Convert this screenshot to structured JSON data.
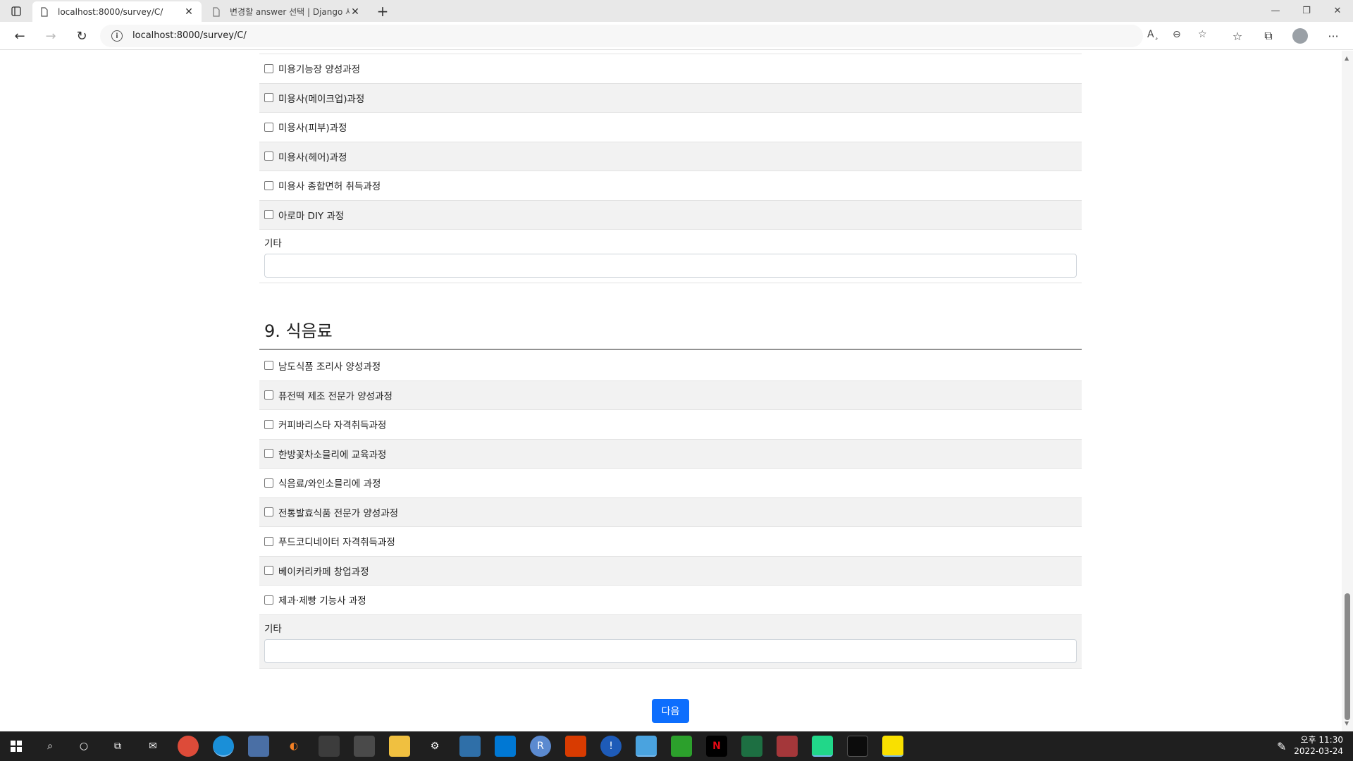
{
  "browser": {
    "tabs": [
      {
        "title": "localhost:8000/survey/C/",
        "active": true
      },
      {
        "title": "변경할 answer 선택 | Django 사이",
        "active": false
      }
    ],
    "url": "localhost:8000/survey/C/",
    "read_aloud": "A¸"
  },
  "section_prev": {
    "options": [
      "미용기능장 양성과정",
      "미용사(메이크업)과정",
      "미용사(피부)과정",
      "미용사(헤어)과정",
      "미용사 종합면허 취득과정",
      "아로마 DIY 과정"
    ],
    "etc_label": "기타"
  },
  "section_9": {
    "title": "9. 식음료",
    "options": [
      "남도식품 조리사 양성과정",
      "퓨전떡 제조 전문가 양성과정",
      "커피바리스타 자격취득과정",
      "한방꽃차소믈리에 교육과정",
      "식음료/와인소믈리에 과정",
      "전통발효식품 전문가 양성과정",
      "푸드코디네이터 자격취득과정",
      "베이커리카페 창업과정",
      "제과·제빵 기능사 과정"
    ],
    "etc_label": "기타"
  },
  "next_button": "다음",
  "taskbar": {
    "time": "오후 11:30",
    "date": "2022-03-24"
  },
  "colors": {
    "primary": "#0d6efd",
    "stripe": "#f2f2f2",
    "taskbar": "#1f1f1f"
  }
}
